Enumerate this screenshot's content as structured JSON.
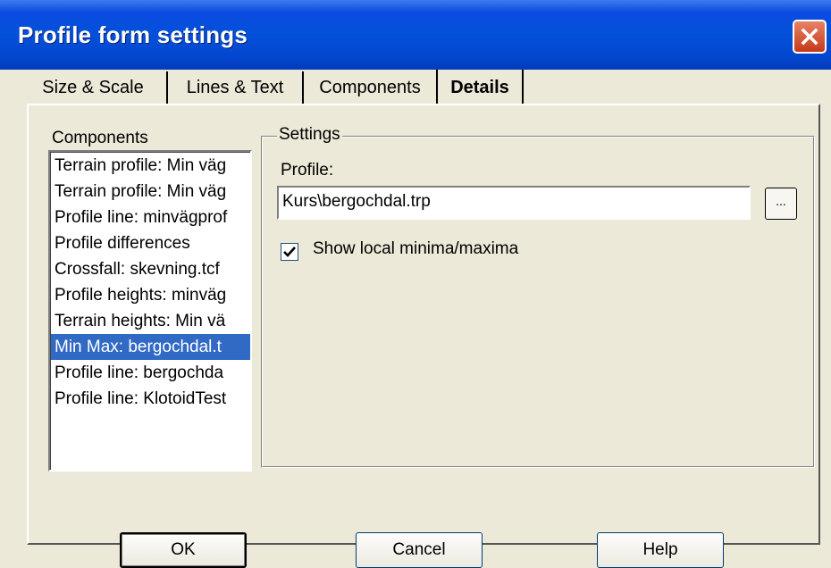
{
  "window": {
    "title": "Profile form settings"
  },
  "tabs": [
    {
      "label": "Size & Scale"
    },
    {
      "label": "Lines & Text"
    },
    {
      "label": "Components"
    },
    {
      "label": "Details",
      "active": true
    }
  ],
  "components": {
    "label": "Components",
    "items": [
      "Terrain profile: Min väg",
      "Terrain profile: Min väg",
      "Profile line: minvägprof",
      "Profile differences",
      "Crossfall: skevning.tcf",
      "Profile heights: minväg",
      "Terrain heights: Min vä",
      "Min Max: bergochdal.t",
      "Profile line: bergochda",
      "Profile line: KlotoidTest"
    ],
    "selected_index": 7
  },
  "settings": {
    "group_label": "Settings",
    "profile_label": "Profile:",
    "profile_value": "Kurs\\bergochdal.trp",
    "browse_label": "...",
    "checkbox_label": "Show local minima/maxima",
    "checkbox_checked": true
  },
  "buttons": {
    "ok": "OK",
    "cancel": "Cancel",
    "help": "Help"
  },
  "colors": {
    "titlebar": "#0451d9",
    "selection": "#316ac5",
    "close": "#c6391a",
    "dialog_bg": "#ece9d8"
  }
}
